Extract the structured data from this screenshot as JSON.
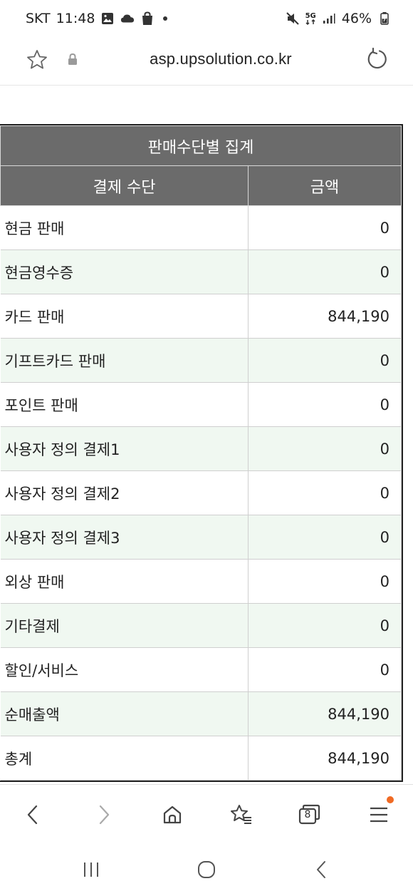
{
  "status_bar": {
    "carrier": "SKT",
    "time": "11:48",
    "network": "5G",
    "battery": "46%"
  },
  "address_bar": {
    "url": "asp.upsolution.co.kr"
  },
  "table": {
    "title": "판매수단별 집계",
    "columns": [
      "결제 수단",
      "금액"
    ],
    "rows": [
      {
        "method": "현금 판매",
        "amount": "0"
      },
      {
        "method": "현금영수증",
        "amount": "0"
      },
      {
        "method": "카드 판매",
        "amount": "844,190"
      },
      {
        "method": "기프트카드 판매",
        "amount": "0"
      },
      {
        "method": "포인트 판매",
        "amount": "0"
      },
      {
        "method": "사용자 정의 결제1",
        "amount": "0"
      },
      {
        "method": "사용자 정의 결제2",
        "amount": "0"
      },
      {
        "method": "사용자 정의 결제3",
        "amount": "0"
      },
      {
        "method": "외상 판매",
        "amount": "0"
      },
      {
        "method": "기타결제",
        "amount": "0"
      },
      {
        "method": "할인/서비스",
        "amount": "0"
      },
      {
        "method": "순매출액",
        "amount": "844,190"
      },
      {
        "method": "총계",
        "amount": "844,190"
      }
    ]
  },
  "bottom_nav": {
    "items": [
      "back-icon",
      "forward-icon",
      "home-icon",
      "bookmarks-icon",
      "tabs-icon",
      "menu-icon"
    ],
    "tab_count": "8",
    "notification_color": "#f06a24"
  },
  "system_nav": {
    "items": [
      "recent-apps-icon",
      "home-circle-icon",
      "system-back-icon"
    ]
  },
  "colors": {
    "header_bg": "#6b6b6b",
    "row_alt_bg": "#f0f8f1"
  }
}
